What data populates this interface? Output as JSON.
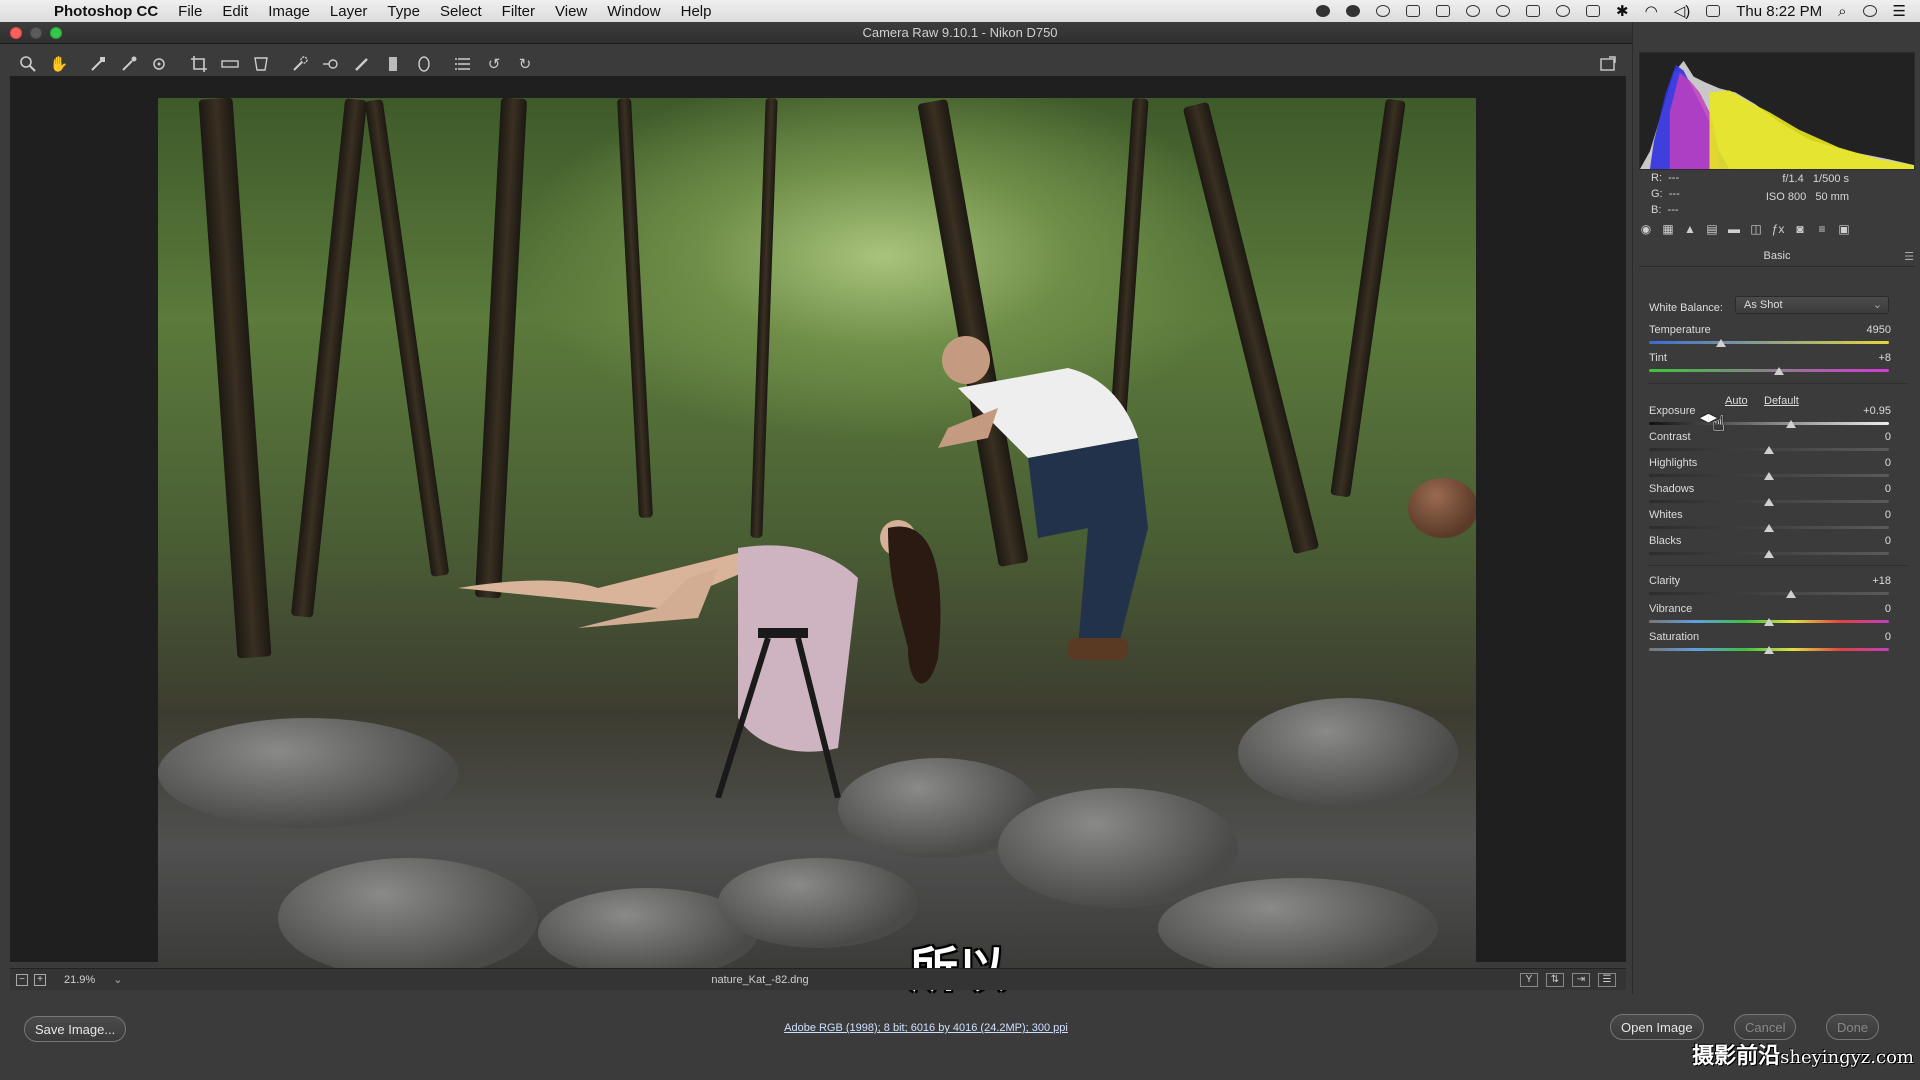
{
  "menubar": {
    "app_name": "Photoshop CC",
    "items": [
      "File",
      "Edit",
      "Image",
      "Layer",
      "Type",
      "Select",
      "Filter",
      "View",
      "Window",
      "Help"
    ],
    "clock": "Thu 8:22 PM"
  },
  "window": {
    "title": "Camera Raw 9.10.1 -  Nikon D750"
  },
  "status": {
    "zoom": "21.9%",
    "filename": "nature_Kat_-82.dng"
  },
  "bottom": {
    "save_label": "Save Image...",
    "workflow_options": "Adobe RGB (1998); 8 bit; 6016 by 4016 (24.2MP); 300 ppi",
    "open_label": "Open Image",
    "cancel_label": "Cancel",
    "done_label": "Done"
  },
  "subtitles": {
    "chinese": "所以",
    "english": "so"
  },
  "watermark": {
    "cn": "摄影前沿",
    "url": "sheyingyz.com"
  },
  "info": {
    "r_label": "R:",
    "r_value": "---",
    "g_label": "G:",
    "g_value": "---",
    "b_label": "B:",
    "b_value": "---",
    "aperture": "f/1.4",
    "shutter": "1/500 s",
    "iso": "ISO 800",
    "focal_length": "50 mm"
  },
  "panel": {
    "title": "Basic",
    "white_balance_label": "White Balance:",
    "white_balance_value": "As Shot",
    "auto_label": "Auto",
    "default_label": "Default",
    "sliders": [
      {
        "label": "Temperature",
        "value": "4950",
        "pos": 0.3
      },
      {
        "label": "Tint",
        "value": "+8",
        "pos": 0.54
      },
      {
        "label": "Exposure",
        "value": "+0.95",
        "pos": 0.59
      },
      {
        "label": "Contrast",
        "value": "0",
        "pos": 0.5
      },
      {
        "label": "Highlights",
        "value": "0",
        "pos": 0.5
      },
      {
        "label": "Shadows",
        "value": "0",
        "pos": 0.5
      },
      {
        "label": "Whites",
        "value": "0",
        "pos": 0.5
      },
      {
        "label": "Blacks",
        "value": "0",
        "pos": 0.5
      },
      {
        "label": "Clarity",
        "value": "+18",
        "pos": 0.59
      },
      {
        "label": "Vibrance",
        "value": "0",
        "pos": 0.5
      },
      {
        "label": "Saturation",
        "value": "0",
        "pos": 0.5
      }
    ]
  },
  "colors": {
    "panel_bg": "#3b3b3b",
    "canvas_bg": "#1f1f1f",
    "temp_track_start": "#3a6cd6",
    "temp_track_end": "#e6d63c",
    "tint_track_start": "#3ec43e",
    "tint_track_end": "#d63ad6"
  },
  "icons": {
    "toolbar": [
      "zoom-icon",
      "hand-icon",
      "white-balance-icon",
      "color-sampler-icon",
      "target-adjust-icon",
      "crop-icon",
      "straighten-icon",
      "transform-icon",
      "spot-removal-icon",
      "red-eye-icon",
      "adjustment-brush-icon",
      "graduated-filter-icon",
      "radial-filter-icon",
      "preferences-icon",
      "rotate-ccw-icon",
      "rotate-cw-icon",
      "fullscreen-icon"
    ]
  }
}
